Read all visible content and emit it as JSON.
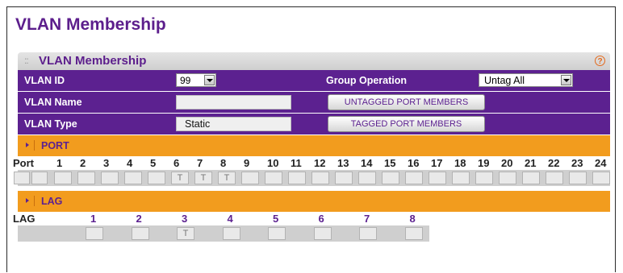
{
  "page_title": "VLAN Membership",
  "panel_title": "VLAN Membership",
  "help_glyph": "?",
  "vlan_id": {
    "label": "VLAN ID",
    "value": "99"
  },
  "group_operation": {
    "label": "Group Operation",
    "value": "Untag All"
  },
  "vlan_name": {
    "label": "VLAN Name",
    "value": ""
  },
  "vlan_type": {
    "label": "VLAN Type",
    "value": "Static"
  },
  "buttons": {
    "untagged": "UNTAGGED PORT MEMBERS",
    "tagged": "TAGGED PORT MEMBERS"
  },
  "port_section": {
    "title": "PORT",
    "row_label": "Port",
    "ports": [
      {
        "n": "1",
        "v": ""
      },
      {
        "n": "2",
        "v": ""
      },
      {
        "n": "3",
        "v": ""
      },
      {
        "n": "4",
        "v": ""
      },
      {
        "n": "5",
        "v": ""
      },
      {
        "n": "6",
        "v": "T"
      },
      {
        "n": "7",
        "v": "T"
      },
      {
        "n": "8",
        "v": "T"
      },
      {
        "n": "9",
        "v": ""
      },
      {
        "n": "10",
        "v": ""
      },
      {
        "n": "11",
        "v": ""
      },
      {
        "n": "12",
        "v": ""
      },
      {
        "n": "13",
        "v": ""
      },
      {
        "n": "14",
        "v": ""
      },
      {
        "n": "15",
        "v": ""
      },
      {
        "n": "16",
        "v": ""
      },
      {
        "n": "17",
        "v": ""
      },
      {
        "n": "18",
        "v": ""
      },
      {
        "n": "19",
        "v": ""
      },
      {
        "n": "20",
        "v": ""
      },
      {
        "n": "21",
        "v": ""
      },
      {
        "n": "22",
        "v": ""
      },
      {
        "n": "23",
        "v": ""
      },
      {
        "n": "24",
        "v": ""
      }
    ]
  },
  "lag_section": {
    "title": "LAG",
    "row_label": "LAG",
    "lags": [
      {
        "n": "1",
        "v": ""
      },
      {
        "n": "2",
        "v": ""
      },
      {
        "n": "3",
        "v": "T"
      },
      {
        "n": "4",
        "v": ""
      },
      {
        "n": "5",
        "v": ""
      },
      {
        "n": "6",
        "v": ""
      },
      {
        "n": "7",
        "v": ""
      },
      {
        "n": "8",
        "v": ""
      }
    ]
  }
}
